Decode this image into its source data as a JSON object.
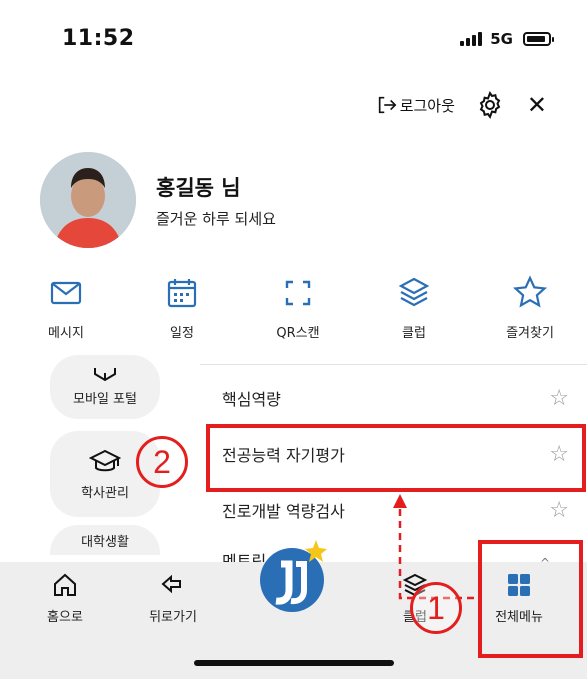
{
  "status_bar": {
    "time": "11:52",
    "network": "5G"
  },
  "header": {
    "logout_label": "로그아웃"
  },
  "profile": {
    "name": "홍길동 님",
    "greeting": "즐거운 하루 되세요"
  },
  "quick_menu": [
    {
      "label": "메시지",
      "icon": "mail-icon"
    },
    {
      "label": "일정",
      "icon": "calendar-icon"
    },
    {
      "label": "QR스캔",
      "icon": "qr-scan-icon"
    },
    {
      "label": "클럽",
      "icon": "layers-icon"
    },
    {
      "label": "즐겨찾기",
      "icon": "star-icon"
    }
  ],
  "side_nav": [
    {
      "label": "모바일 포털",
      "icon": "portal-icon"
    },
    {
      "label": "학사관리",
      "icon": "graduation-cap-icon"
    },
    {
      "label": "대학생활",
      "icon": "campus-icon"
    }
  ],
  "submenu": [
    {
      "label": "핵심역량"
    },
    {
      "label": "전공능력 자기평가"
    },
    {
      "label": "진로개발 역량검사"
    },
    {
      "label": "멘토링"
    }
  ],
  "tab_bar": {
    "home": "홈으로",
    "back": "뒤로가기",
    "club": "클럽",
    "all_menu": "전체메뉴"
  },
  "annotations": {
    "step1": "1",
    "step2": "2",
    "color": "#e41e1e"
  },
  "colors": {
    "accent_blue": "#2a6fb6",
    "logo_yellow": "#f5c518"
  }
}
